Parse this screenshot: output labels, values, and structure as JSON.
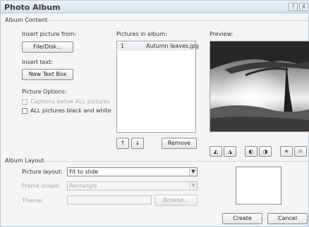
{
  "window": {
    "title": "Photo Album",
    "help_label": "?",
    "close_label": "X"
  },
  "album_content": {
    "group_label": "Album Content",
    "insert_picture_from_label": "Insert picture from:",
    "file_disk_button": "File/Disk...",
    "insert_text_label": "Insert text:",
    "new_text_box_button": "New Text Box",
    "picture_options_label": "Picture Options:",
    "captions_below_label": "Captions below ALL pictures",
    "captions_below_checked": false,
    "captions_below_disabled": true,
    "black_white_label": "ALL pictures black and white",
    "black_white_checked": false,
    "pictures_in_album_label": "Pictures in album:",
    "pictures": [
      {
        "index": "1",
        "name": "Autumn leaves.jpg",
        "selected": true
      }
    ],
    "move_up_label": "↑",
    "move_down_label": "↓",
    "remove_button": "Remove",
    "preview_label": "Preview:",
    "preview_tools": [
      {
        "icon": "rotate-left-icon",
        "glyph": "◭"
      },
      {
        "icon": "rotate-right-icon",
        "glyph": "◮"
      },
      {
        "icon": "contrast-up-icon",
        "glyph": "◐"
      },
      {
        "icon": "contrast-down-icon",
        "glyph": "◑"
      },
      {
        "icon": "brightness-up-icon",
        "glyph": "☀"
      },
      {
        "icon": "brightness-down-icon",
        "glyph": "☼"
      }
    ]
  },
  "album_layout": {
    "group_label": "Album Layout",
    "picture_layout_label": "Picture layout:",
    "picture_layout_value": "Fit to slide",
    "frame_shape_label": "Frame shape:",
    "frame_shape_value": "Rectangle",
    "theme_label": "Theme:",
    "theme_value": "",
    "browse_button": "Browse..."
  },
  "actions": {
    "create_button": "Create",
    "cancel_button": "Cancel"
  }
}
